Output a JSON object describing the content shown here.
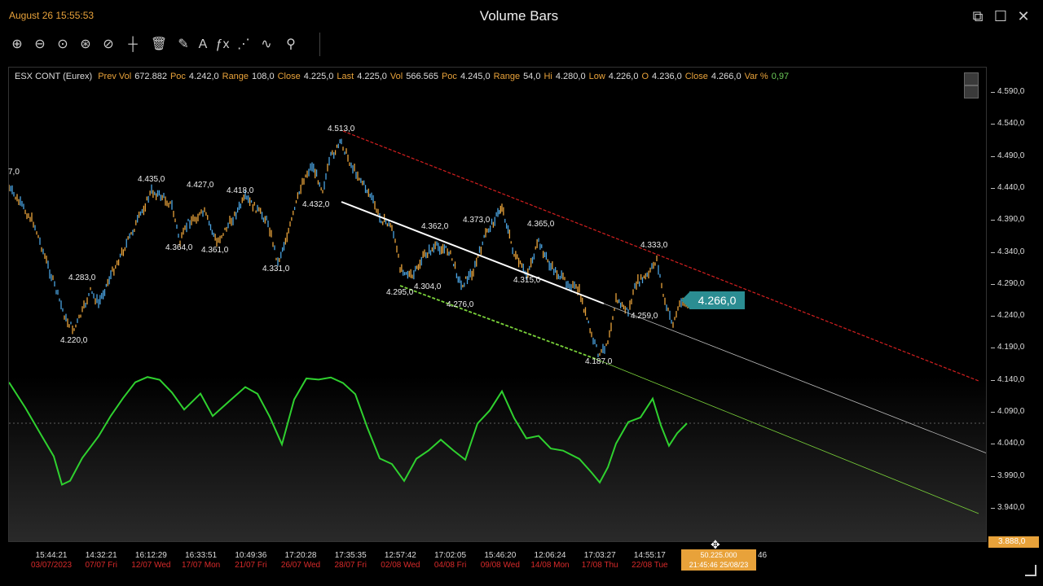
{
  "window": {
    "clock": "August 26 15:55:53",
    "title": "Volume Bars"
  },
  "toolbar": {
    "tools": [
      {
        "name": "zoom-in-icon",
        "glyph": "⊕"
      },
      {
        "name": "zoom-out-icon",
        "glyph": "⊖"
      },
      {
        "name": "zoom-fit-icon",
        "glyph": "⊙"
      },
      {
        "name": "zoom-area-icon",
        "glyph": "⊛"
      },
      {
        "name": "zoom-fx-icon",
        "glyph": "⊘"
      },
      {
        "name": "crosshair-icon",
        "glyph": "┼"
      },
      {
        "name": "trash-icon",
        "glyph": "🗑"
      },
      {
        "name": "pen-icon",
        "glyph": "✎"
      },
      {
        "name": "text-icon",
        "glyph": "A"
      },
      {
        "name": "fx-icon",
        "glyph": "ƒx"
      },
      {
        "name": "trendline-icon",
        "glyph": "⋰"
      },
      {
        "name": "wave-icon",
        "glyph": "∿"
      },
      {
        "name": "fib-icon",
        "glyph": "⚲"
      }
    ]
  },
  "info_bar": {
    "symbol": "ESX CONT (Eurex)",
    "fields": [
      {
        "label": "Prev Vol",
        "value": "672.882"
      },
      {
        "label": "Poc",
        "value": "4.242,0"
      },
      {
        "label": "Range",
        "value": "108,0"
      },
      {
        "label": "Close",
        "value": "4.225,0"
      },
      {
        "label": "Last",
        "value": "4.225,0"
      },
      {
        "label": "Vol",
        "value": "566.565"
      },
      {
        "label": "Poc",
        "value": "4.245,0"
      },
      {
        "label": "Range",
        "value": "54,0"
      },
      {
        "label": "Hi",
        "value": "4.280,0"
      },
      {
        "label": "Low",
        "value": "4.226,0"
      },
      {
        "label": "O",
        "value": "4.236,0"
      },
      {
        "label": "Close",
        "value": "4.266,0"
      },
      {
        "label": "Var %",
        "value": "0,97"
      }
    ]
  },
  "current_price": "4.266,0",
  "price_labels": [
    {
      "text": "4.513,0"
    },
    {
      "text": "4.435,0"
    },
    {
      "text": "4.427,0"
    },
    {
      "text": "4.418,0"
    },
    {
      "text": "4.432,0"
    },
    {
      "text": "4.364,0"
    },
    {
      "text": "4.361,0"
    },
    {
      "text": "4.331,0"
    },
    {
      "text": "4.283,0"
    },
    {
      "text": "4.220,0"
    },
    {
      "text": "4.362,0"
    },
    {
      "text": "4.373,0"
    },
    {
      "text": "4.365,0"
    },
    {
      "text": "4.333,0"
    },
    {
      "text": "4.304,0"
    },
    {
      "text": "4.295,0"
    },
    {
      "text": "4.276,0"
    },
    {
      "text": "4.315,0"
    },
    {
      "text": "4.259,0"
    },
    {
      "text": "4.187,0"
    },
    {
      "text": "7,0"
    }
  ],
  "y_axis": {
    "labels": [
      "4.590,0",
      "4.540,0",
      "4.490,0",
      "4.440,0",
      "4.390,0",
      "4.340,0",
      "4.290,0",
      "4.240,0",
      "4.190,0",
      "4.140,0",
      "4.090,0",
      "4.040,0",
      "3.990,0",
      "3.940,0"
    ],
    "last": "3.888,0"
  },
  "x_axis": {
    "ticks": [
      {
        "t": "15:44:21",
        "d": "03/07/2023"
      },
      {
        "t": "14:32:21",
        "d": "07/07 Fri"
      },
      {
        "t": "16:12:29",
        "d": "12/07 Wed"
      },
      {
        "t": "16:33:51",
        "d": "17/07 Mon"
      },
      {
        "t": "10:49:36",
        "d": "21/07 Fri"
      },
      {
        "t": "17:20:28",
        "d": "26/07 Wed"
      },
      {
        "t": "17:35:35",
        "d": "28/07 Fri"
      },
      {
        "t": "12:57:42",
        "d": "02/08 Wed"
      },
      {
        "t": "17:02:05",
        "d": "04/08 Fri"
      },
      {
        "t": "15:46:20",
        "d": "09/08 Wed"
      },
      {
        "t": "12:06:24",
        "d": "14/08 Mon"
      },
      {
        "t": "17:03:27",
        "d": "17/08 Thu"
      },
      {
        "t": "14:55:17",
        "d": "22/08 Tue"
      }
    ],
    "cursor": {
      "line1": "50.225.000",
      "line2": "21:45:46 25/08/23"
    },
    "trailing": "46"
  },
  "colors": {
    "accent": "#e8a23a",
    "price_up": "#4aa3e0",
    "price_down": "#e8a23a",
    "osc": "#2fd12f",
    "red_line": "#d41f1f",
    "green_line": "#7ad23a",
    "date_red": "#d92a2a",
    "price_box": "#2b8d92"
  }
}
